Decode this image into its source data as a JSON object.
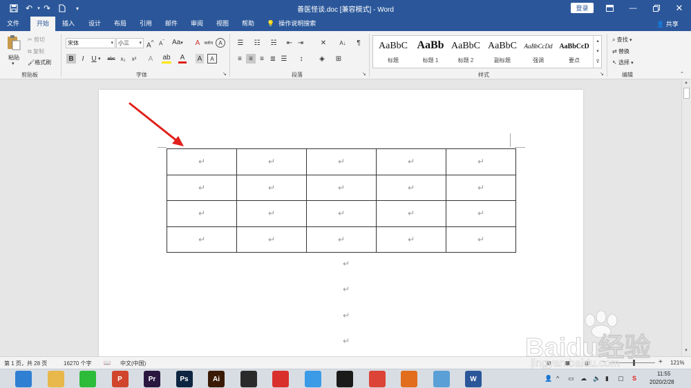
{
  "titlebar": {
    "doc_title": "善医怪谈.doc [兼容模式] - Word",
    "login_label": "登录",
    "quick_access": [
      {
        "name": "save-icon",
        "glyph": "💾"
      },
      {
        "name": "undo-icon",
        "glyph": "↶"
      },
      {
        "name": "redo-icon",
        "glyph": "↷"
      },
      {
        "name": "new-doc-icon",
        "glyph": "🗋"
      },
      {
        "name": "customize-icon",
        "glyph": "▾"
      }
    ],
    "window_controls": [
      "ribbon-display-icon",
      "minimize-icon",
      "restore-icon",
      "close-icon"
    ]
  },
  "tabs": {
    "items": [
      "文件",
      "开始",
      "插入",
      "设计",
      "布局",
      "引用",
      "邮件",
      "审阅",
      "视图",
      "帮助"
    ],
    "active": "开始",
    "tell_me": "操作说明搜索",
    "share": "共享"
  },
  "ribbon": {
    "clipboard": {
      "paste": "粘贴",
      "cut": "剪切",
      "copy": "复制",
      "format_painter": "格式刷",
      "label": "剪贴板"
    },
    "font": {
      "font_name": "宋体",
      "font_size": "小三",
      "grow": "A",
      "shrink": "A",
      "case": "Aa",
      "bold": "B",
      "italic": "I",
      "underline": "U",
      "strike": "abc",
      "subscript": "x₂",
      "superscript": "x²",
      "label": "字体"
    },
    "paragraph": {
      "label": "段落"
    },
    "styles": {
      "items": [
        {
          "sample": "AaBbC",
          "name": "标题"
        },
        {
          "sample": "AaBb",
          "name": "标题 1"
        },
        {
          "sample": "AaBbC",
          "name": "标题 2"
        },
        {
          "sample": "AaBbC",
          "name": "副标题"
        },
        {
          "sample": "AaBbCcDd",
          "name": "强调"
        },
        {
          "sample": "AaBbCcD",
          "name": "要点"
        }
      ],
      "label": "样式"
    },
    "editing": {
      "find": "查找",
      "replace": "替换",
      "select": "选择",
      "label": "编辑"
    }
  },
  "document": {
    "table_rows": [
      [
        "↵",
        "↵",
        "↵",
        "↵",
        "↵"
      ],
      [
        "↵",
        "↵",
        "↵",
        "↵",
        "↵"
      ],
      [
        "↵",
        "↵",
        "↵",
        "↵",
        "↵"
      ],
      [
        "↵",
        "↵",
        "↵",
        "↵",
        "↵"
      ]
    ],
    "trailing_marks": [
      "↵",
      "↵",
      "↵",
      "↵"
    ],
    "arrow_color": "#e0201b"
  },
  "statusbar": {
    "page": "第 1 页，共 28 页",
    "words": "16270 个字",
    "language": "中文(中国)",
    "zoom": "121%"
  },
  "taskbar": {
    "apps": [
      {
        "name": "browser-360-icon",
        "label": "",
        "color": "#2f7fd3"
      },
      {
        "name": "file-explorer-icon",
        "label": "",
        "color": "#e8b84a"
      },
      {
        "name": "wechat-icon",
        "label": "",
        "color": "#2dbb3a"
      },
      {
        "name": "powerpoint-icon",
        "label": "P",
        "color": "#d0452b"
      },
      {
        "name": "premiere-icon",
        "label": "Pr",
        "color": "#2a1740"
      },
      {
        "name": "photoshop-icon",
        "label": "Ps",
        "color": "#0d2540"
      },
      {
        "name": "illustrator-icon",
        "label": "Ai",
        "color": "#3a1a05"
      },
      {
        "name": "video-editor-icon",
        "label": "",
        "color": "#2a2a2a"
      },
      {
        "name": "xmind-icon",
        "label": "",
        "color": "#d9302c"
      },
      {
        "name": "qq-browser-icon",
        "label": "",
        "color": "#3b9be6"
      },
      {
        "name": "qq-icon",
        "label": "",
        "color": "#1a1a1a"
      },
      {
        "name": "chrome-icon",
        "label": "",
        "color": "#db4437"
      },
      {
        "name": "foxmail-icon",
        "label": "",
        "color": "#e26d1c"
      },
      {
        "name": "notepad-icon",
        "label": "",
        "color": "#5a9fd6"
      },
      {
        "name": "word-icon",
        "label": "W",
        "color": "#2b579a"
      }
    ],
    "time": "11:55",
    "date": "2020/2/28"
  },
  "watermark": {
    "brand": "Baidu经验",
    "url": "jingyan.baidu.com"
  }
}
